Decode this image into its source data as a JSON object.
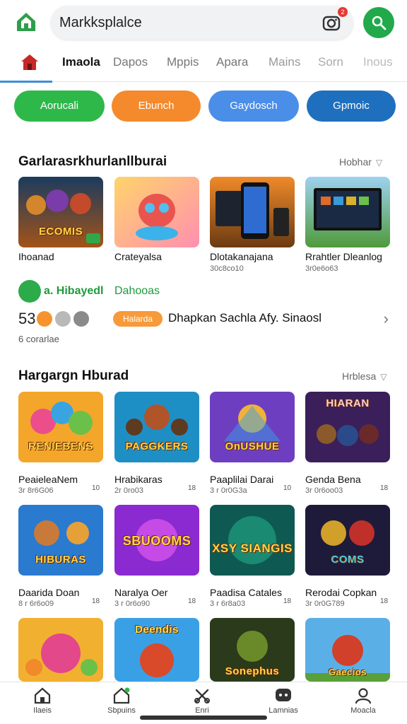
{
  "app": {
    "search_value": "Markksplalce",
    "camera_badge": "2"
  },
  "tabs": [
    {
      "label": "Imaola"
    },
    {
      "label": "Dapos"
    },
    {
      "label": "Mppis"
    },
    {
      "label": "Apara"
    },
    {
      "label": "Mains"
    },
    {
      "label": "Sorn"
    },
    {
      "label": "Inous"
    }
  ],
  "pills": [
    {
      "label": "Aorucali",
      "color": "#2fb84a"
    },
    {
      "label": "Ebunch",
      "color": "#f58a2c"
    },
    {
      "label": "Gaydosch",
      "color": "#4a8ee8"
    },
    {
      "label": "Gpmoic",
      "color": "#1f6fbf"
    }
  ],
  "section1": {
    "title": "Garlarasrkhurlanllburai",
    "more": "Hobhar",
    "cards": [
      {
        "name": "Ihoanad",
        "sub": "",
        "art": "ECOMIS"
      },
      {
        "name": "Crateyalsa",
        "sub": "",
        "art": ""
      },
      {
        "name": "Dlotakanajana",
        "sub": "30c8co10",
        "art": ""
      },
      {
        "name": "Rrahtler Dleanlog",
        "sub": "3r0e6o63",
        "art": ""
      }
    ]
  },
  "promo": {
    "title": "a. Hibayedl",
    "subtitle": "Dahooas",
    "number": "53",
    "chip": "Halarda",
    "text": "Dhapkan Sachla Afy. Sinaosl",
    "footer": "6 corarlae"
  },
  "section2": {
    "title": "Hargargn Hburad",
    "more": "Hrblesa",
    "rows": [
      [
        {
          "name": "PeaieleaNem",
          "sub": "3r 8r6G06",
          "badge": "10",
          "art": "RENIEBENS"
        },
        {
          "name": "Hrabikaras",
          "sub": "2r 0ro03",
          "badge": "18",
          "art": "PAGGKERS"
        },
        {
          "name": "Paaplilai Darai",
          "sub": "3 r 0r0G3a",
          "badge": "10",
          "art": "OnUSHUE"
        },
        {
          "name": "Genda Bena",
          "sub": "3r 0r6oo03",
          "badge": "18",
          "art": "HIARAN"
        }
      ],
      [
        {
          "name": "Daarida Doan",
          "sub": "8 r 6r6o09",
          "badge": "18",
          "art": "HIBURAS"
        },
        {
          "name": "Naralya Oer",
          "sub": "3 r 0r6o90",
          "badge": "18",
          "art": "SBUOOMS"
        },
        {
          "name": "Paadisa Catales",
          "sub": "3 r 6r8a03",
          "badge": "18",
          "art": "XSY SIANGIS"
        },
        {
          "name": "Rerodai Copkan",
          "sub": "3r 0r0G789",
          "badge": "18",
          "art": "COMS"
        }
      ],
      [
        {
          "name": "",
          "sub": "",
          "badge": "",
          "art": ""
        },
        {
          "name": "",
          "sub": "",
          "badge": "",
          "art": "Deendis"
        },
        {
          "name": "",
          "sub": "",
          "badge": "",
          "art": "Sonephus"
        },
        {
          "name": "",
          "sub": "",
          "badge": "",
          "art": "Gaecios"
        }
      ]
    ]
  },
  "bottom_nav": [
    {
      "label": "Ilaeis",
      "icon": "home-icon"
    },
    {
      "label": "Sbpuins",
      "icon": "store-icon"
    },
    {
      "label": "Enri",
      "icon": "tools-icon"
    },
    {
      "label": "Lamnias",
      "icon": "chat-icon"
    },
    {
      "label": "Moacla",
      "icon": "person-icon"
    }
  ]
}
